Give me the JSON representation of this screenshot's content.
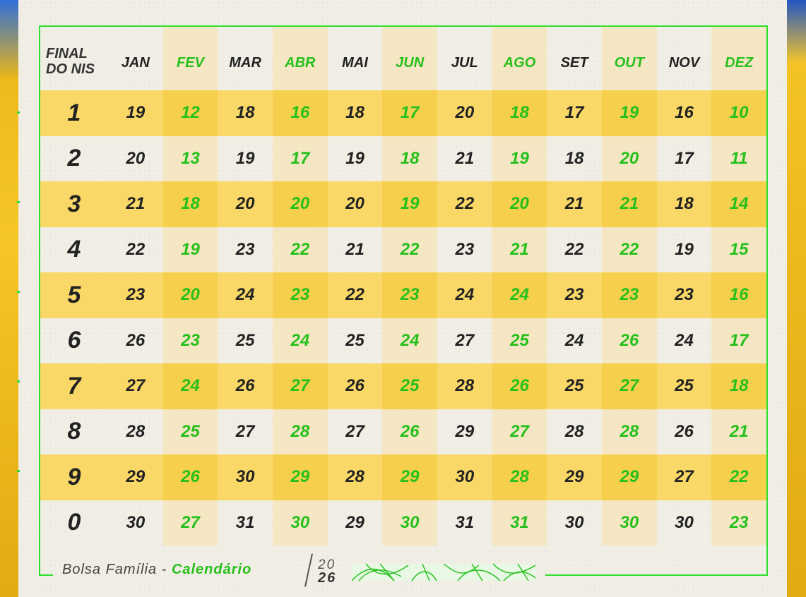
{
  "header": {
    "corner_line1": "FINAL",
    "corner_line2_a": "DO",
    "corner_line2_b": "NIS",
    "months": [
      "JAN",
      "FEV",
      "MAR",
      "ABR",
      "MAI",
      "JUN",
      "JUL",
      "AGO",
      "SET",
      "OUT",
      "NOV",
      "DEZ"
    ]
  },
  "rows": [
    {
      "nis": "1",
      "days": [
        "19",
        "12",
        "18",
        "16",
        "18",
        "17",
        "20",
        "18",
        "17",
        "19",
        "16",
        "10"
      ]
    },
    {
      "nis": "2",
      "days": [
        "20",
        "13",
        "19",
        "17",
        "19",
        "18",
        "21",
        "19",
        "18",
        "20",
        "17",
        "11"
      ]
    },
    {
      "nis": "3",
      "days": [
        "21",
        "18",
        "20",
        "20",
        "20",
        "19",
        "22",
        "20",
        "21",
        "21",
        "18",
        "14"
      ]
    },
    {
      "nis": "4",
      "days": [
        "22",
        "19",
        "23",
        "22",
        "21",
        "22",
        "23",
        "21",
        "22",
        "22",
        "19",
        "15"
      ]
    },
    {
      "nis": "5",
      "days": [
        "23",
        "20",
        "24",
        "23",
        "22",
        "23",
        "24",
        "24",
        "23",
        "23",
        "23",
        "16"
      ]
    },
    {
      "nis": "6",
      "days": [
        "26",
        "23",
        "25",
        "24",
        "25",
        "24",
        "27",
        "25",
        "24",
        "26",
        "24",
        "17"
      ]
    },
    {
      "nis": "7",
      "days": [
        "27",
        "24",
        "26",
        "27",
        "26",
        "25",
        "28",
        "26",
        "25",
        "27",
        "25",
        "18"
      ]
    },
    {
      "nis": "8",
      "days": [
        "28",
        "25",
        "27",
        "28",
        "27",
        "26",
        "29",
        "27",
        "28",
        "28",
        "26",
        "21"
      ]
    },
    {
      "nis": "9",
      "days": [
        "29",
        "26",
        "30",
        "29",
        "28",
        "29",
        "30",
        "28",
        "29",
        "29",
        "27",
        "22"
      ]
    },
    {
      "nis": "0",
      "days": [
        "30",
        "27",
        "31",
        "30",
        "29",
        "30",
        "31",
        "31",
        "30",
        "30",
        "30",
        "23"
      ]
    }
  ],
  "footer": {
    "title_prefix": "Bolsa Família - ",
    "title_accent": "Calendário",
    "year_top": "20",
    "year_bottom": "26"
  },
  "colors": {
    "accent_green": "#26c01c",
    "frame_green": "#2ee02e",
    "band_yellow": "#f9d867",
    "paper": "#f1eee5",
    "text_dark": "#222222"
  }
}
